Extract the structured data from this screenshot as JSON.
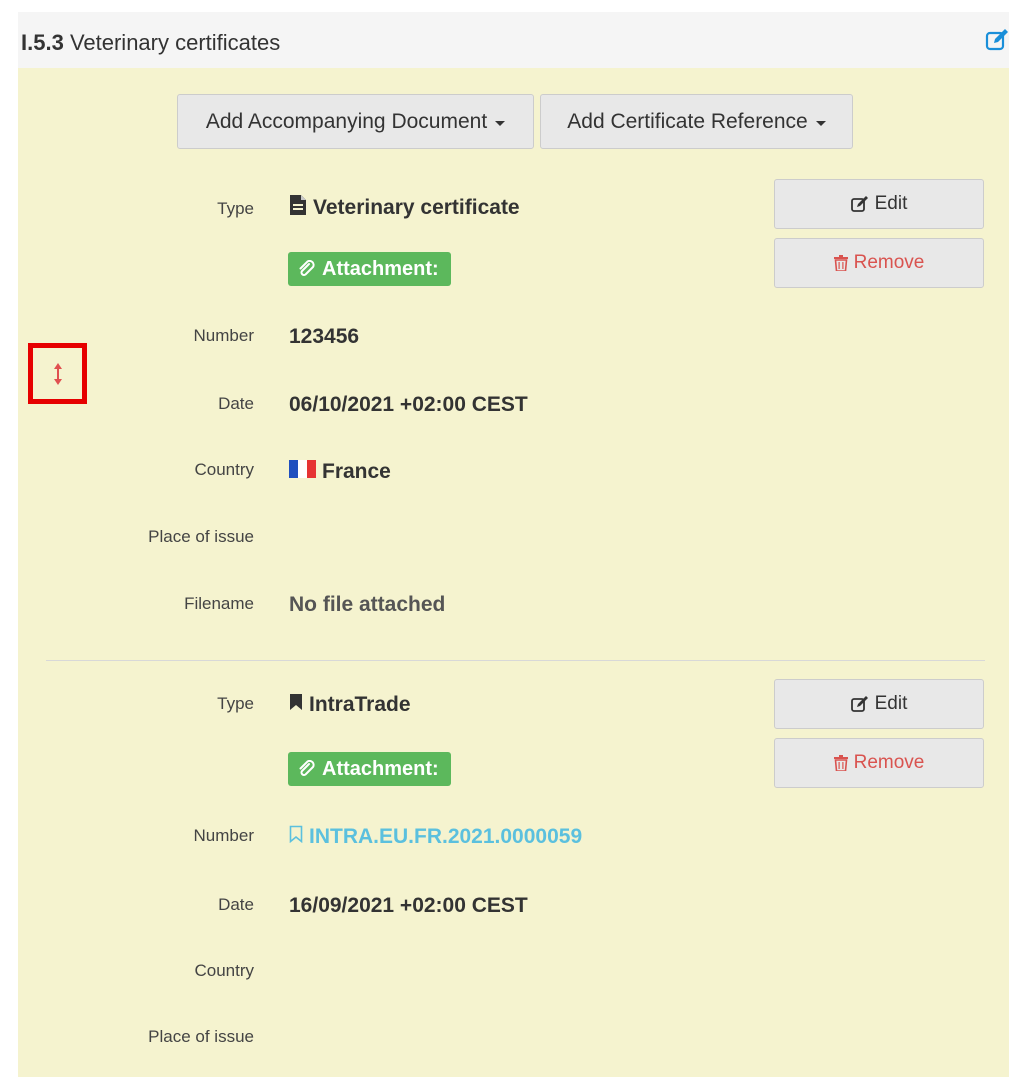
{
  "section": {
    "number": "I.5.3",
    "title": "Veterinary certificates",
    "edit_icon": "edit-icon"
  },
  "toolbar": {
    "add_document_label": "Add Accompanying Document",
    "add_reference_label": "Add Certificate Reference"
  },
  "labels": {
    "type": "Type",
    "number": "Number",
    "date": "Date",
    "country": "Country",
    "place_of_issue": "Place of issue",
    "filename": "Filename"
  },
  "entries": [
    {
      "type": "Veterinary certificate",
      "type_icon": "file-icon",
      "attachment_label": "Attachment:",
      "number": "123456",
      "date": "06/10/2021 +02:00 CEST",
      "country": "France",
      "country_icon": "flag-france-icon",
      "place_of_issue": "",
      "filename": "No file attached",
      "edit_label": "Edit",
      "remove_label": "Remove"
    },
    {
      "type": "IntraTrade",
      "type_icon": "bookmark-icon",
      "attachment_label": "Attachment:",
      "number": "INTRA.EU.FR.2021.0000059",
      "number_icon": "bookmark-outline-icon",
      "date": "16/09/2021 +02:00 CEST",
      "country": "",
      "place_of_issue": "",
      "edit_label": "Edit",
      "remove_label": "Remove"
    }
  ],
  "colors": {
    "panel_background": "#f5f3cf",
    "attachment_badge": "#5cb85c",
    "remove_text": "#d9534f",
    "link_text": "#5bc0de",
    "highlight_box": "#e60000",
    "edit_icon": "#1a8fd9"
  }
}
